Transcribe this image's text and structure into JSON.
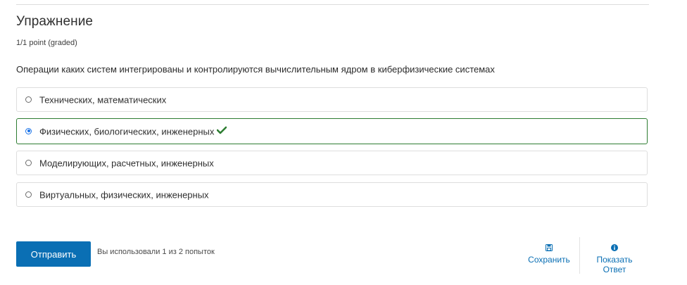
{
  "exercise": {
    "title": "Упражнение",
    "points": "1/1 point (graded)",
    "question": "Операции каких систем интегрированы и контролируются вычислительным ядром в киберфизические системах"
  },
  "options": [
    {
      "label": "Технических, математических",
      "selected": false,
      "correct": false
    },
    {
      "label": "Физических, биологических, инженерных",
      "selected": true,
      "correct": true
    },
    {
      "label": "Моделирующих, расчетных, инженерных",
      "selected": false,
      "correct": false
    },
    {
      "label": "Виртуальных, физических, инженерных",
      "selected": false,
      "correct": false
    }
  ],
  "footer": {
    "submit_label": "Отправить",
    "attempts_text": "Вы использовали 1 из 2 попыток",
    "save_label": "Сохранить",
    "show_answer_line1": "Показать",
    "show_answer_line2": "Ответ"
  },
  "colors": {
    "accent": "#0a6fb4",
    "correct": "#2e7d32",
    "radio_selected": "#1a73e8"
  },
  "icons": {
    "check": "check-icon",
    "save": "save-icon",
    "info": "info-icon"
  }
}
